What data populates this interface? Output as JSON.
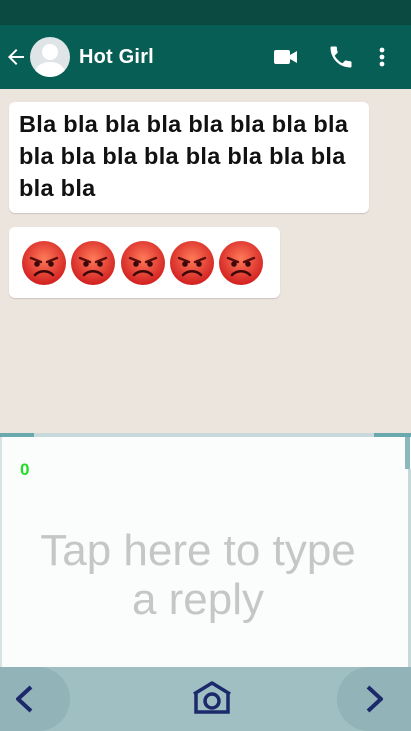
{
  "header": {
    "contact_name": "Hot Girl",
    "icons": [
      "back-arrow-icon",
      "avatar-placeholder-icon",
      "video-call-icon",
      "phone-icon",
      "more-vert-icon"
    ]
  },
  "messages": [
    {
      "type": "text",
      "text": "Bla bla bla bla bla bla bla bla bla bla bla bla bla bla bla bla bla bla"
    },
    {
      "type": "emoji",
      "emojis": [
        "angry-face",
        "angry-face",
        "angry-face",
        "angry-face",
        "angry-face"
      ]
    }
  ],
  "reply": {
    "char_count": "0",
    "placeholder": "Tap here to type a reply"
  },
  "nav": {
    "icons": [
      "previous-icon",
      "home-icon",
      "next-icon"
    ]
  },
  "colors": {
    "app_bar": "#075e54",
    "status_bar": "#0b4a40",
    "chat_background": "#ece5dd",
    "counter_green": "#22dd22",
    "nav_bar": "#9fbfc3"
  }
}
